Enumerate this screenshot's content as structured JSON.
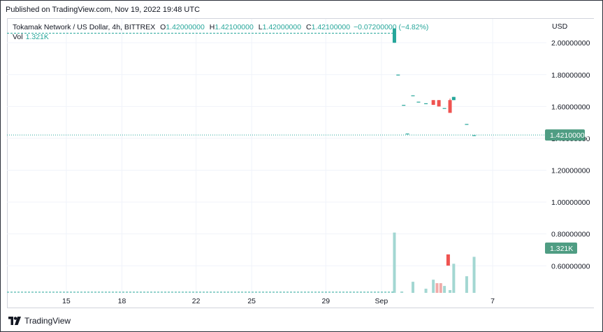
{
  "published": "Published on TradingView.com, Nov 19, 2022 19:48 UTC",
  "legend": {
    "symbol": "Tokamak Network / US Dollar, 4h, BITTREX",
    "o_label": "O",
    "o_value": "1.42000000",
    "h_label": "H",
    "h_value": "1.42100000",
    "l_label": "L",
    "l_value": "1.42000000",
    "c_label": "C",
    "c_value": "1.42100000",
    "change": "−0.07200000 (−4.82%)"
  },
  "volume_legend": {
    "label": "Vol",
    "value": "1.321K"
  },
  "currency": "USD",
  "footer": {
    "brand": "TradingView"
  },
  "colors": {
    "up": "#26a69a",
    "down": "#ef5350",
    "vol_up": "#a3d7d2",
    "vol_down": "#f0aaa8",
    "price_badge": "#4f9d83",
    "grid": "#f0f3fa"
  },
  "chart_data": {
    "type": "candlestick",
    "y_ticks": [
      "2.00000000",
      "1.80000000",
      "1.60000000",
      "1.40000000",
      "1.20000000",
      "1.00000000",
      "0.80000000",
      "0.60000000"
    ],
    "y_tick_values": [
      2.0,
      1.8,
      1.6,
      1.4,
      1.2,
      1.0,
      0.8,
      0.6
    ],
    "ylim": [
      0.43,
      2.15
    ],
    "x_ticks": [
      "15",
      "18",
      "22",
      "25",
      "29",
      "Sep",
      "7"
    ],
    "x_tick_days": [
      15,
      18,
      22,
      25,
      29,
      32,
      38
    ],
    "x_range_days": [
      11.8,
      40.9
    ],
    "last_price": 1.421,
    "last_price_label": "1.42100000",
    "high_line": 2.06,
    "volume_label": "1.321K",
    "candles": [
      {
        "day": 32.7,
        "o": 2.0,
        "h": 2.09,
        "l": 2.0,
        "c": 2.09
      },
      {
        "day": 32.9,
        "o": 1.8,
        "h": 1.8,
        "l": 1.8,
        "c": 1.8
      },
      {
        "day": 33.2,
        "o": 1.61,
        "h": 1.61,
        "l": 1.61,
        "c": 1.61
      },
      {
        "day": 33.4,
        "o": 1.43,
        "h": 1.43,
        "l": 1.43,
        "c": 1.43
      },
      {
        "day": 33.7,
        "o": 1.67,
        "h": 1.67,
        "l": 1.67,
        "c": 1.67
      },
      {
        "day": 34.0,
        "o": 1.63,
        "h": 1.63,
        "l": 1.63,
        "c": 1.63
      },
      {
        "day": 34.4,
        "o": 1.62,
        "h": 1.62,
        "l": 1.62,
        "c": 1.62
      },
      {
        "day": 34.8,
        "o": 1.64,
        "h": 1.64,
        "l": 1.61,
        "c": 1.61
      },
      {
        "day": 35.1,
        "o": 1.64,
        "h": 1.64,
        "l": 1.6,
        "c": 1.6
      },
      {
        "day": 35.4,
        "o": 1.59,
        "h": 1.59,
        "l": 1.59,
        "c": 1.59
      },
      {
        "day": 35.7,
        "o": 1.64,
        "h": 1.65,
        "l": 1.56,
        "c": 1.56
      },
      {
        "day": 35.9,
        "o": 1.64,
        "h": 1.66,
        "l": 1.64,
        "c": 1.66
      },
      {
        "day": 36.6,
        "o": 1.49,
        "h": 1.49,
        "l": 1.49,
        "c": 1.49
      },
      {
        "day": 37.0,
        "o": 1.42,
        "h": 1.42,
        "l": 1.42,
        "c": 1.42
      }
    ],
    "volume_bars": [
      {
        "day": 32.7,
        "v": 0.87,
        "dir": "up"
      },
      {
        "day": 33.1,
        "v": 0.02,
        "dir": "up"
      },
      {
        "day": 33.7,
        "v": 0.16,
        "dir": "up"
      },
      {
        "day": 34.4,
        "v": 0.06,
        "dir": "up"
      },
      {
        "day": 34.8,
        "v": 0.19,
        "dir": "up"
      },
      {
        "day": 35.0,
        "v": 0.14,
        "dir": "down"
      },
      {
        "day": 35.2,
        "v": 0.14,
        "dir": "down"
      },
      {
        "day": 35.4,
        "v": 0.1,
        "dir": "up"
      },
      {
        "day": 35.7,
        "v": 0.04,
        "dir": "up"
      },
      {
        "day": 35.9,
        "v": 0.42,
        "dir": "up"
      },
      {
        "day": 36.6,
        "v": 0.24,
        "dir": "up"
      },
      {
        "day": 37.0,
        "v": 0.52,
        "dir": "up"
      }
    ],
    "volume_ylim": [
      0,
      1.5
    ]
  }
}
